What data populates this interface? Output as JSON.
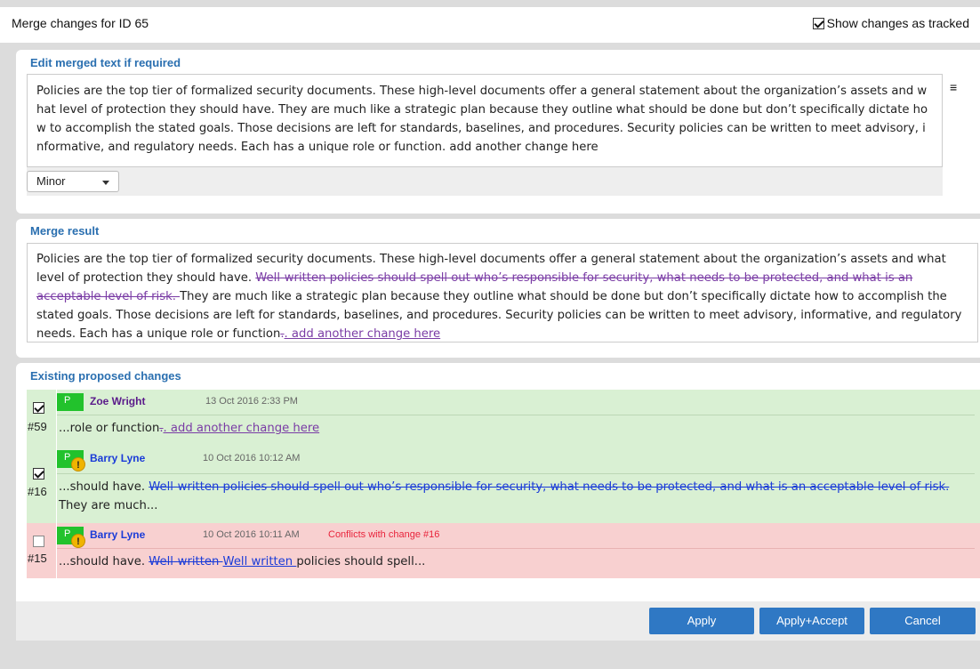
{
  "dialog": {
    "title": "Merge changes for ID 65",
    "show_tracked_label": "Show changes as tracked"
  },
  "edit": {
    "heading": "Edit merged text if required",
    "text": "Policies are the top tier of formalized security documents. These high-level documents offer a general statement about the organization’s assets and what level of protection they should have. They are much like a strategic plan because they outline what should be done but don’t specifically dictate how to accomplish the stated goals. Those decisions are left for standards, baselines, and procedures. Security policies can be written to meet advisory, informative, and regulatory needs. Each has a unique role or function. add another change here",
    "menu_icon": "hamburger-icon",
    "dropdown_value": "Minor"
  },
  "result": {
    "heading": "Merge result",
    "t1": "Policies are the top tier of formalized security documents. These high-level documents offer a general statement about the organization’s assets and what level of protection they should have. ",
    "del1": "Well-written policies should spell out who’s responsible for security, what needs to be protected, and what is an acceptable level of risk. ",
    "t2": "They are much like a strategic plan because they outline what should be done but don’t specifically dictate how to accomplish the stated goals. Those decisions are left for standards, baselines, and procedures. Security policies can be written to meet advisory, informative, and regulatory needs. Each has a unique role or function",
    "del2": ".",
    "ins2": ". add another change here"
  },
  "existing": {
    "heading": "Existing proposed changes",
    "changes": [
      {
        "number": "#59",
        "badge": "P",
        "author": "Zoe Wright",
        "date": "13 Oct 2016 2:33 PM",
        "pre": "...role or function",
        "del": ".",
        "ins": ". add another change here",
        "post": ""
      },
      {
        "number": "#16",
        "badge": "P",
        "warn": "!",
        "author": "Barry Lyne",
        "date": "10 Oct 2016 10:12 AM",
        "pre": "...should have. ",
        "del": "Well-written policies should spell out who’s responsible for security, what needs to be protected, and what is an acceptable level of risk. ",
        "post": "They are much..."
      },
      {
        "number": "#15",
        "badge": "P",
        "warn": "!",
        "author": "Barry Lyne",
        "date": "10 Oct 2016 10:11 AM",
        "conflict": "Conflicts with change #16",
        "pre": "...should have. ",
        "del": "Well-written ",
        "ins": "Well written ",
        "post": "policies should spell..."
      }
    ]
  },
  "buttons": {
    "apply": "Apply",
    "apply_accept": "Apply+Accept",
    "cancel": "Cancel"
  }
}
